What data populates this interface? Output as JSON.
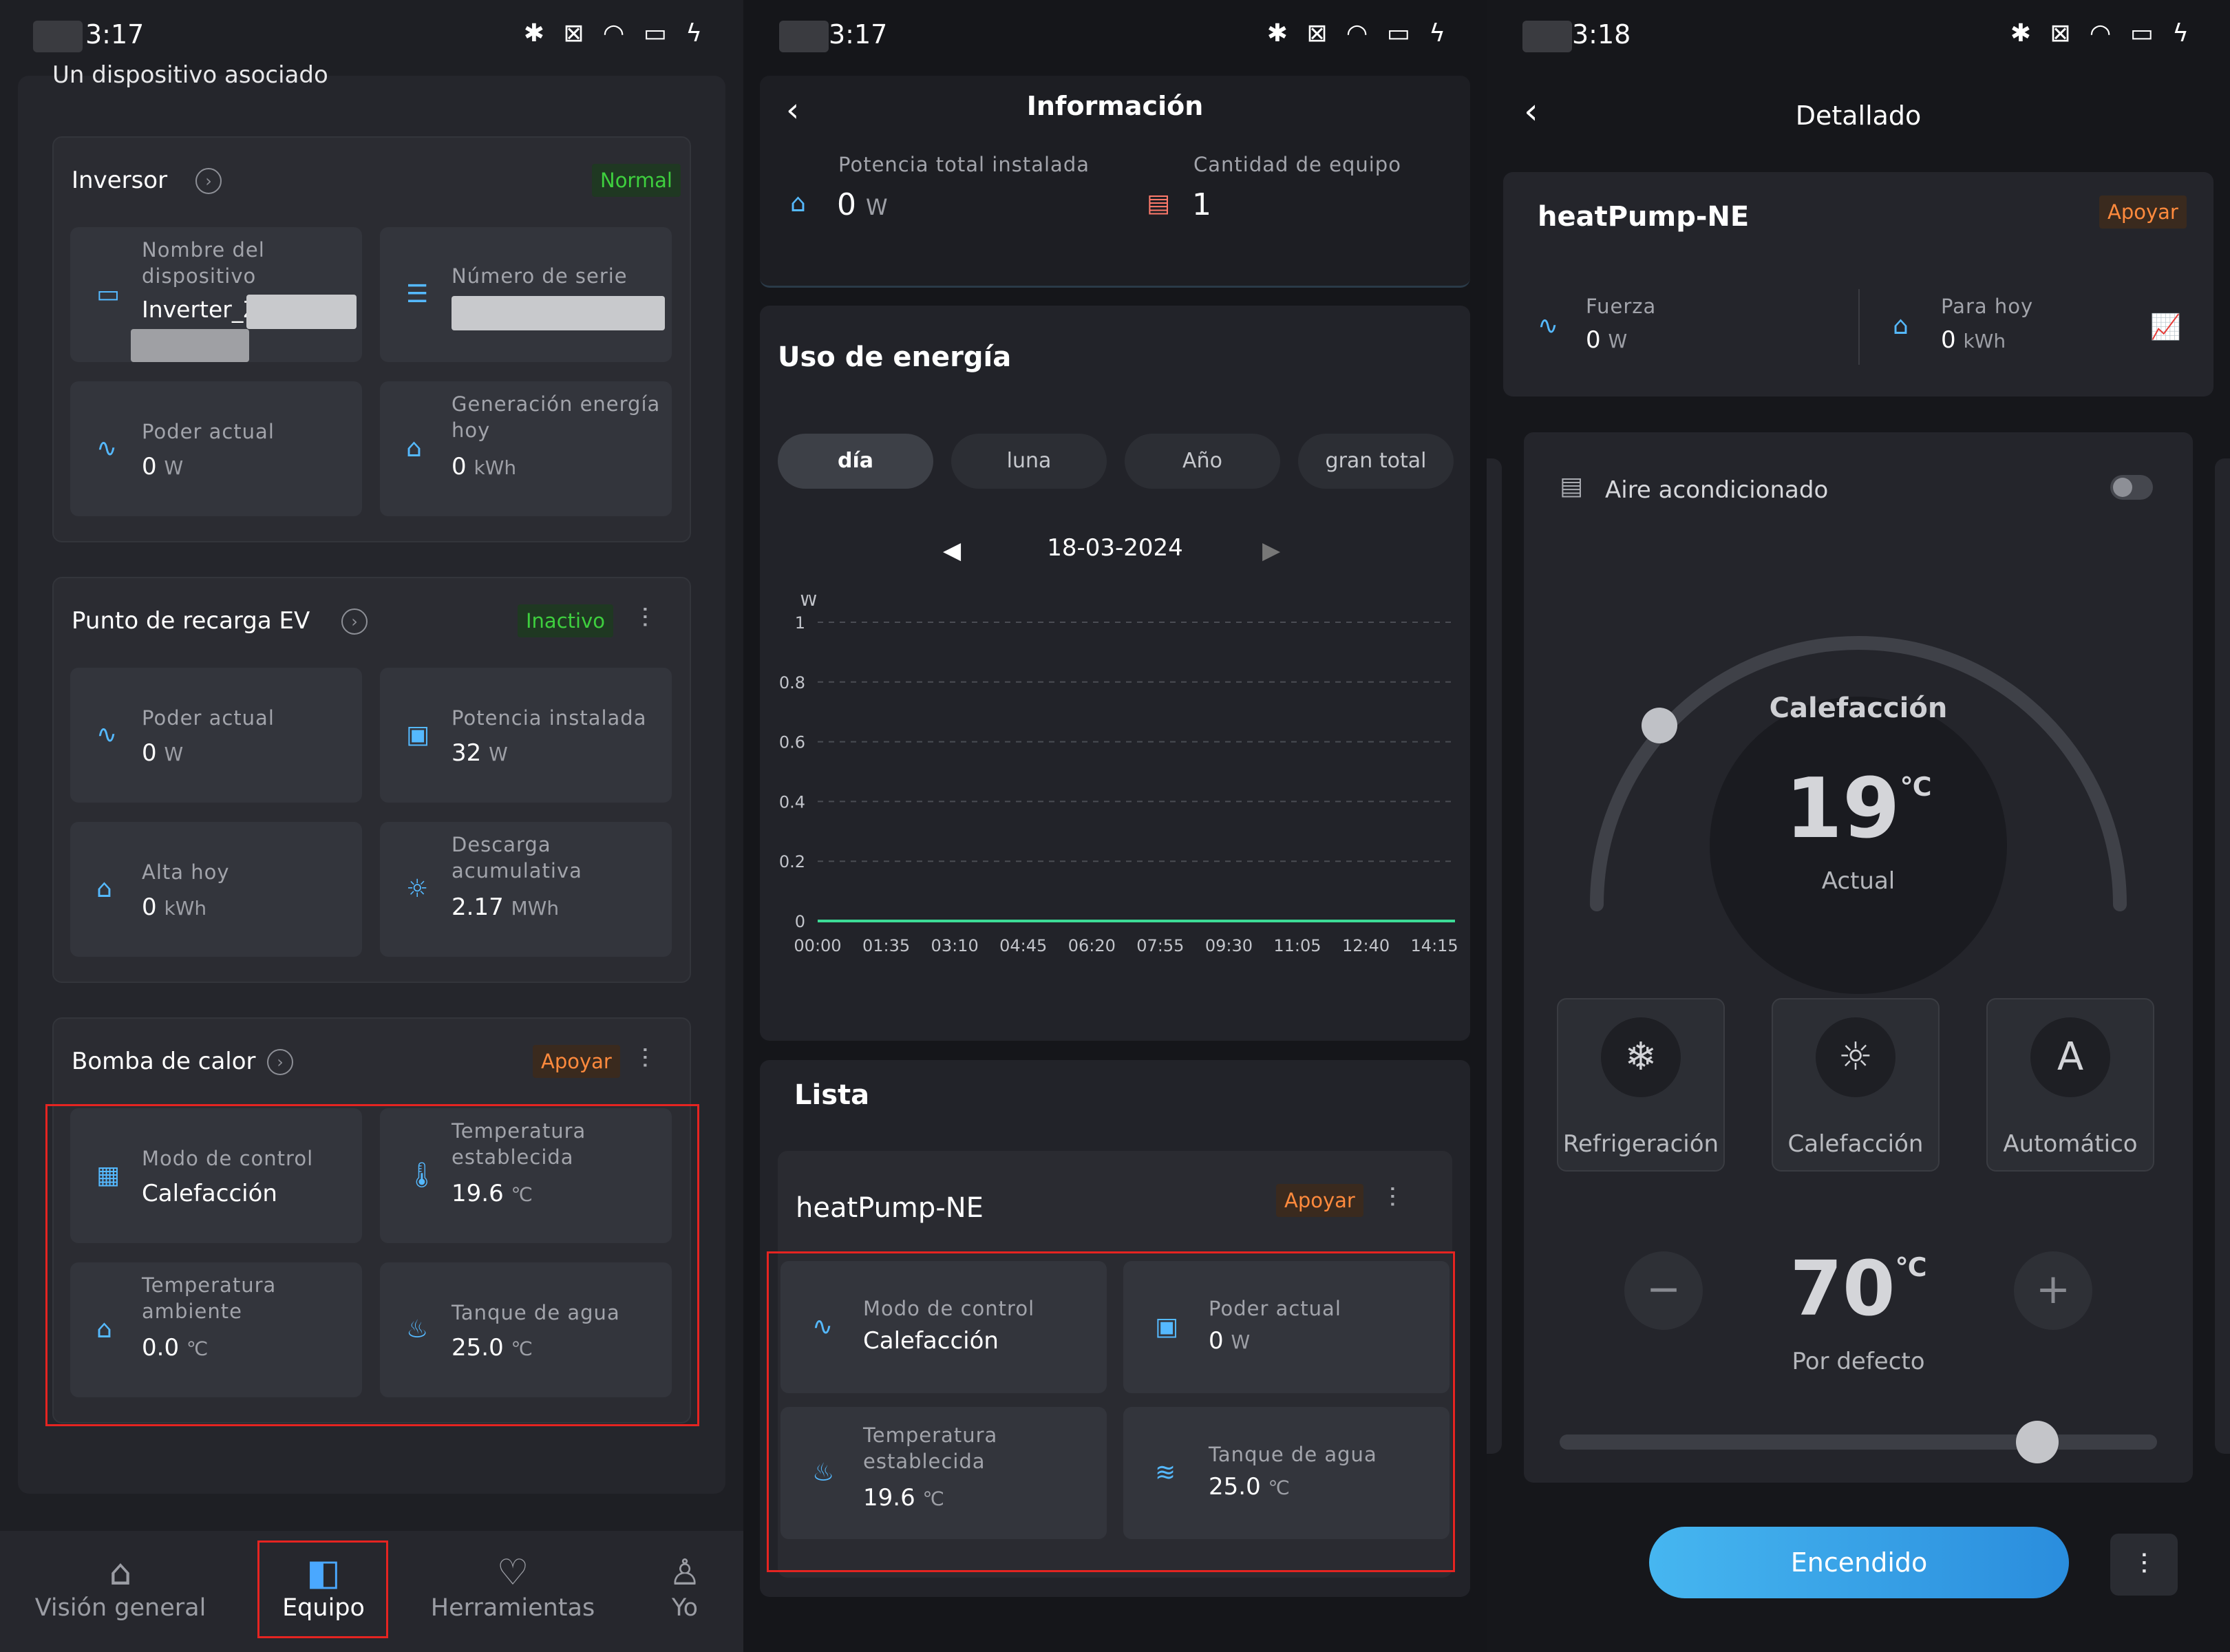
{
  "colors": {
    "accent": "#55b9ff",
    "normal": "#3ecf3e",
    "apoyar": "#ff8a3d",
    "redbox": "#e52421"
  },
  "screen1": {
    "status": {
      "time": "3:17",
      "icons": "✱ ⊠ ◠ ▭ ϟ"
    },
    "partial_header": "Un dispositivo asociado",
    "inverter": {
      "title": "Inversor",
      "status": "Normal",
      "device_name_label": "Nombre del dispositivo",
      "device_name_value": "Inverter_Z",
      "serial_label": "Número de serie",
      "power_label": "Poder actual",
      "power_value": "0",
      "power_unit": "W",
      "gen_label": "Generación energía hoy",
      "gen_value": "0",
      "gen_unit": "kWh"
    },
    "ev": {
      "title": "Punto de recarga EV",
      "status": "Inactivo",
      "power_label": "Poder actual",
      "power_value": "0",
      "power_unit": "W",
      "installed_label": "Potencia instalada",
      "installed_value": "32",
      "installed_unit": "W",
      "today_label": "Alta hoy",
      "today_value": "0",
      "today_unit": "kWh",
      "acc_label": "Descarga acumulativa",
      "acc_value": "2.17",
      "acc_unit": "MWh"
    },
    "heatpump": {
      "title": "Bomba de calor",
      "status": "Apoyar",
      "mode_label": "Modo de control",
      "mode_value": "Calefacción",
      "settemp_label": "Temperatura establecida",
      "settemp_value": "19.6",
      "settemp_unit": "℃",
      "ambient_label": "Temperatura ambiente",
      "ambient_value": "0.0",
      "ambient_unit": "℃",
      "tank_label": "Tanque de agua",
      "tank_value": "25.0",
      "tank_unit": "℃"
    },
    "nav": {
      "overview": "Visión general",
      "equipment": "Equipo",
      "tools": "Herramientas",
      "me": "Yo"
    }
  },
  "screen2": {
    "status": {
      "time": "3:17",
      "icons": "✱ ⊠ ◠ ▭ ϟ"
    },
    "title": "Información",
    "installed_label": "Potencia total instalada",
    "installed_value": "0",
    "installed_unit": "W",
    "qty_label": "Cantidad de equipo",
    "qty_value": "1",
    "energy_title": "Uso de energía",
    "tabs": {
      "day": "día",
      "month": "luna",
      "year": "Año",
      "total": "gran total"
    },
    "date": "18-03-2024",
    "list_title": "Lista",
    "device": {
      "name": "heatPump-NE",
      "status": "Apoyar",
      "mode_label": "Modo de control",
      "mode_value": "Calefacción",
      "power_label": "Poder actual",
      "power_value": "0",
      "power_unit": "W",
      "settemp_label": "Temperatura establecida",
      "settemp_value": "19.6",
      "settemp_unit": "℃",
      "tank_label": "Tanque de agua",
      "tank_value": "25.0",
      "tank_unit": "℃"
    }
  },
  "chart_data": {
    "type": "line",
    "ylabel": "W",
    "ylim": [
      0,
      1
    ],
    "yticks": [
      "0",
      "0.2",
      "0.4",
      "0.6",
      "0.8",
      "1"
    ],
    "categories": [
      "00:00",
      "01:35",
      "03:10",
      "04:45",
      "06:20",
      "07:55",
      "09:30",
      "11:05",
      "12:40",
      "14:15"
    ],
    "series": [
      {
        "values": [
          0,
          0,
          0,
          0,
          0,
          0,
          0,
          0,
          0,
          0
        ]
      }
    ],
    "grid": true
  },
  "screen3": {
    "status": {
      "time": "3:18",
      "icons": "✱ ⊠ ◠ ▭ ϟ"
    },
    "title": "Detallado",
    "device_name": "heatPump-NE",
    "status_badge": "Apoyar",
    "force_label": "Fuerza",
    "force_value": "0",
    "force_unit": "W",
    "today_label": "Para hoy",
    "today_value": "0",
    "today_unit": "kWh",
    "ac_label": "Aire acondicionado",
    "dial_mode": "Calefacción",
    "dial_temp": "19",
    "dial_unit": "℃",
    "dial_caption": "Actual",
    "modes": {
      "cool": "Refrigeración",
      "heat": "Calefacción",
      "auto": "Automático"
    },
    "set_temp": "70",
    "set_unit": "℃",
    "set_caption": "Por defecto",
    "slider_fraction": 0.8,
    "power_button": "Encendido"
  }
}
